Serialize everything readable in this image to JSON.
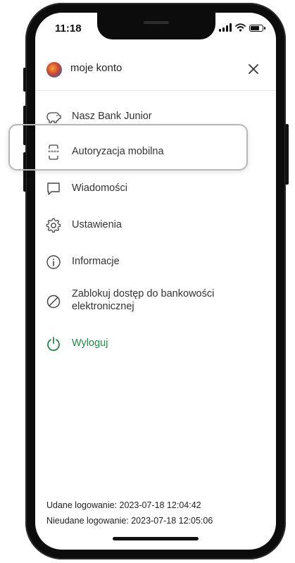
{
  "status_bar": {
    "time": "11:18"
  },
  "header": {
    "title": "moje konto",
    "close_icon": "close-icon"
  },
  "menu": {
    "items": [
      {
        "label": "Nasz Bank Junior",
        "icon": "piggy-bank-icon"
      },
      {
        "label": "Autoryzacja mobilna",
        "icon": "mobile-authorization-icon"
      },
      {
        "label": "Wiadomości",
        "icon": "message-icon"
      },
      {
        "label": "Ustawienia",
        "icon": "gear-icon"
      },
      {
        "label": "Informacje",
        "icon": "info-icon"
      },
      {
        "label_line1": "Zablokuj dostęp do bankowości",
        "label_line2": "elektronicznej",
        "icon": "block-icon"
      },
      {
        "label": "Wyloguj",
        "icon": "power-icon"
      }
    ]
  },
  "footer": {
    "last_login": "Udane logowanie: 2023-07-18 12:04:42",
    "failed_login": "Nieudane logowanie: 2023-07-18 12:05:06"
  },
  "colors": {
    "accent": "#1f8a46",
    "text": "#333333",
    "highlight_border": "#b7b7b7"
  }
}
